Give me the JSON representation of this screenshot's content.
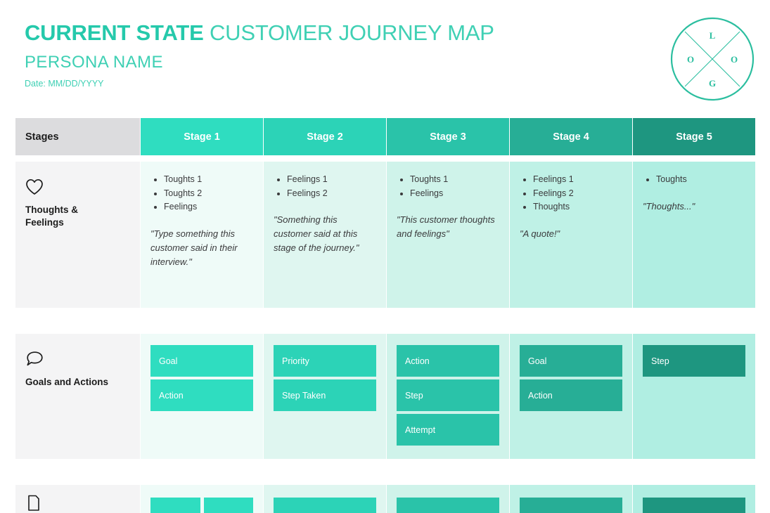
{
  "header": {
    "title_strong": "CURRENT STATE",
    "title_light": " CUSTOMER JOURNEY MAP",
    "persona": "PERSONA NAME",
    "date": "Date: MM/DD/YYYY",
    "logo_letters": {
      "top": "L",
      "left": "O",
      "right": "O",
      "bottom": "G"
    }
  },
  "colors": {
    "brand_teal": "#25C9AB",
    "title_light_teal": "#3FD0B4",
    "label_header_gray": "#DCDCDE",
    "label_cell_gray": "#F4F4F5",
    "stage_headers": [
      "#2FDDC0",
      "#2CD3B7",
      "#2AC3A9",
      "#27AE96",
      "#1E9680"
    ],
    "stage_cell_tints": [
      "#EFFBF8",
      "#DFF6F0",
      "#CFF3EA",
      "#BFF1E6",
      "#B0EEE2"
    ],
    "chip_fills": [
      "#2FDDC0",
      "#2CD3B7",
      "#2AC3A9",
      "#27AE96",
      "#1E9680"
    ]
  },
  "stages_header": {
    "label": "Stages",
    "stages": [
      "Stage 1",
      "Stage 2",
      "Stage 3",
      "Stage 4",
      "Stage 5"
    ]
  },
  "rows": [
    {
      "id": "thoughts-and-feelings",
      "label": "Thoughts &\nFeelings",
      "icon": "heart-icon",
      "cells": [
        {
          "bullets": [
            "Toughts 1",
            "Toughts 2",
            "Feelings"
          ],
          "quote": "\"Type something this customer said in their interview.\""
        },
        {
          "bullets": [
            "Feelings 1",
            "Feelings 2"
          ],
          "quote": "\"Something this customer said at this stage of the journey.\""
        },
        {
          "bullets": [
            "Toughts 1",
            "Feelings"
          ],
          "quote": "\"This customer thoughts and feelings\""
        },
        {
          "bullets": [
            "Feelings 1",
            "Feelings 2",
            "Thoughts"
          ],
          "quote": "\"A quote!\""
        },
        {
          "bullets": [
            "Toughts"
          ],
          "quote": "\"Thoughts...\""
        }
      ]
    },
    {
      "id": "goals-and-actions",
      "label": "Goals and Actions",
      "icon": "speech-bubble-icon",
      "cells": [
        {
          "chips": [
            "Goal",
            "Action"
          ]
        },
        {
          "chips": [
            "Priority",
            "Step Taken"
          ]
        },
        {
          "chips": [
            "Action",
            "Step",
            "Attempt"
          ]
        },
        {
          "chips": [
            "Goal",
            "Action"
          ]
        },
        {
          "chips": [
            "Step"
          ]
        }
      ]
    },
    {
      "id": "third-row",
      "label": "",
      "icon": "document-icon",
      "cells": [
        {
          "chip_pair": [
            "",
            ""
          ]
        },
        {
          "chips": [
            ""
          ]
        },
        {
          "chips": [
            ""
          ]
        },
        {
          "chips": [
            ""
          ]
        },
        {
          "chips": [
            ""
          ]
        }
      ]
    }
  ]
}
